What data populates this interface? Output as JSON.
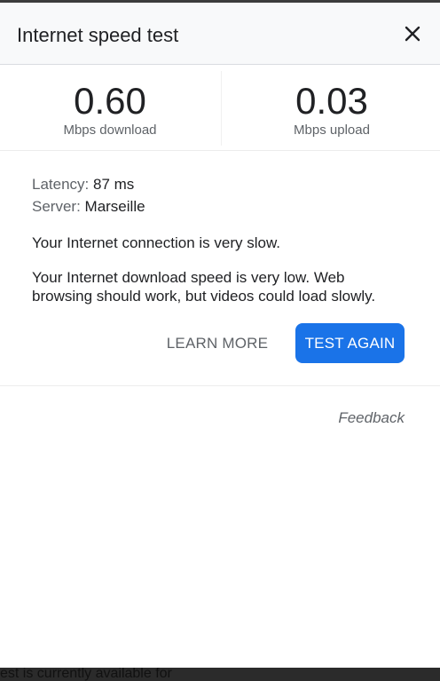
{
  "header": {
    "title": "Internet speed test",
    "close_icon": "close-icon"
  },
  "results": {
    "download": {
      "value": "0.60",
      "unit": "Mbps download"
    },
    "upload": {
      "value": "0.03",
      "unit": "Mbps upload"
    }
  },
  "details": {
    "latency_label": "Latency:",
    "latency_value": "87 ms",
    "server_label": "Server:",
    "server_value": "Marseille",
    "message_1": "Your Internet connection is very slow.",
    "message_2": "Your Internet download speed is very low. Web browsing should work, but videos could load slowly."
  },
  "actions": {
    "learn_more": "LEARN MORE",
    "test_again": "TEST AGAIN"
  },
  "feedback": "Feedback",
  "background_text": "est is currently available for",
  "colors": {
    "accent": "#1a73e8",
    "text_primary": "#202124",
    "text_secondary": "#5f6368",
    "header_bg": "#f8f9fa"
  }
}
